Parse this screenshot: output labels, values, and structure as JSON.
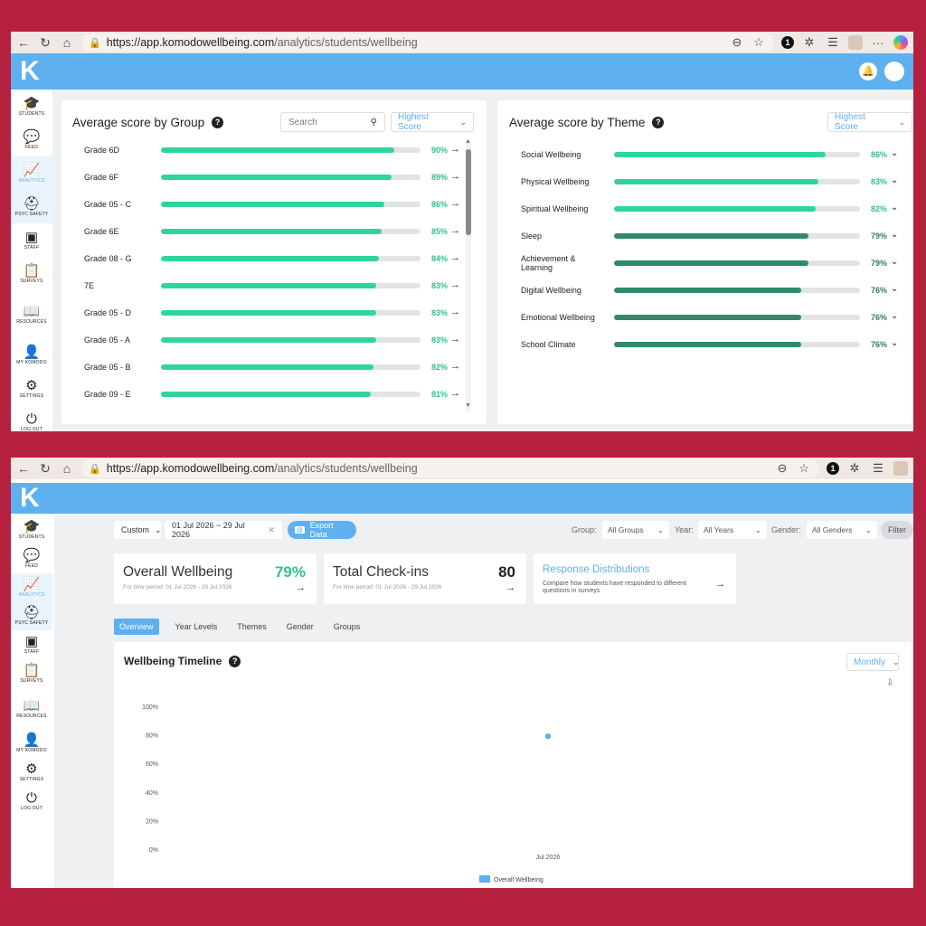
{
  "browser": {
    "url_host": "https://app.komodowellbeing.com",
    "url_path": "/analytics/students/wellbeing",
    "extension_badge": "1"
  },
  "app": {
    "logo_letter": "K"
  },
  "sidebar": {
    "items": [
      {
        "label": "STUDENTS",
        "icon": "graduation-cap-icon"
      },
      {
        "label": "FEED",
        "icon": "chat-bubble-icon"
      },
      {
        "label": "ANALYTICS",
        "icon": "chart-line-icon"
      },
      {
        "label": "PSYC SAFETY",
        "icon": "hard-hat-icon"
      },
      {
        "label": "STAFF",
        "icon": "id-badge-icon"
      },
      {
        "label": "SURVEYS",
        "icon": "clipboard-icon"
      },
      {
        "label": "RESOURCES",
        "icon": "book-icon"
      },
      {
        "label": "MY KOMODO",
        "icon": "person-icon"
      },
      {
        "label": "SETTINGS",
        "icon": "gear-icon"
      },
      {
        "label": "LOG OUT",
        "icon": "power-icon"
      }
    ]
  },
  "group_card": {
    "title": "Average score by Group",
    "search_placeholder": "Search",
    "sort_label": "Highest Score",
    "rows": [
      {
        "label": "Grade 6D",
        "pct": "90%",
        "value": 0.9
      },
      {
        "label": "Grade 6F",
        "pct": "89%",
        "value": 0.89
      },
      {
        "label": "Grade 05 - C",
        "pct": "86%",
        "value": 0.86
      },
      {
        "label": "Grade 6E",
        "pct": "85%",
        "value": 0.85
      },
      {
        "label": "Grade 08 - G",
        "pct": "84%",
        "value": 0.84
      },
      {
        "label": "7E",
        "pct": "83%",
        "value": 0.83
      },
      {
        "label": "Grade 05 - D",
        "pct": "83%",
        "value": 0.83
      },
      {
        "label": "Grade 05 - A",
        "pct": "83%",
        "value": 0.83
      },
      {
        "label": "Grade 05 - B",
        "pct": "82%",
        "value": 0.82
      },
      {
        "label": "Grade 09 - E",
        "pct": "81%",
        "value": 0.81
      }
    ]
  },
  "theme_card": {
    "title": "Average score by Theme",
    "sort_label": "Highest Score",
    "rows": [
      {
        "label": "Social Wellbeing",
        "pct": "86%",
        "value": 0.86,
        "tone": "light"
      },
      {
        "label": "Physical Wellbeing",
        "pct": "83%",
        "value": 0.83,
        "tone": "light"
      },
      {
        "label": "Spiritual Wellbeing",
        "pct": "82%",
        "value": 0.82,
        "tone": "light"
      },
      {
        "label": "Sleep",
        "pct": "79%",
        "value": 0.79,
        "tone": "dark"
      },
      {
        "label": "Achievement &",
        "label2": "Learning",
        "pct": "79%",
        "value": 0.79,
        "tone": "dark"
      },
      {
        "label": "Digital Wellbeing",
        "pct": "76%",
        "value": 0.76,
        "tone": "dark"
      },
      {
        "label": "Emotional Wellbeing",
        "pct": "76%",
        "value": 0.76,
        "tone": "dark"
      },
      {
        "label": "School Climate",
        "pct": "76%",
        "value": 0.76,
        "tone": "dark"
      }
    ]
  },
  "colors": {
    "accent": "#5eb0ef",
    "bar_light": "#2fd698",
    "bar_dark": "#2e8a6a",
    "pct_light": "#2fc38a",
    "pct_dark": "#2e7d62"
  },
  "filters": {
    "range_label": "Custom",
    "date_range": "01 Jul 2026 ~ 29 Jul 2026",
    "export_label": "Export Data",
    "group_label": "Group:",
    "group_value": "All Groups",
    "year_label": "Year:",
    "year_value": "All Years",
    "gender_label": "Gender:",
    "gender_value": "All Genders",
    "filter_button": "Filter"
  },
  "stats": {
    "overall": {
      "title": "Overall Wellbeing",
      "value": "79%",
      "sub": "For time period: 01 Jul 2026 - 29 Jul 2026"
    },
    "checkins": {
      "title": "Total Check-ins",
      "value": "80",
      "sub": "For time period: 01 Jul 2026 - 29 Jul 2026"
    },
    "responses": {
      "title": "Response Distributions",
      "desc": "Compare how students have responded to different questions in surveys"
    }
  },
  "tabs": [
    "Overview",
    "Year Levels",
    "Themes",
    "Gender",
    "Groups"
  ],
  "timeline": {
    "title": "Wellbeing Timeline",
    "interval": "Monthly"
  },
  "chart_data": {
    "type": "line",
    "x": [
      "Jul 2026"
    ],
    "series": [
      {
        "name": "Overall Wellbeing",
        "values": [
          79
        ]
      }
    ],
    "yticks": [
      "100%",
      "80%",
      "60%",
      "40%",
      "20%",
      "0%"
    ],
    "ylim": [
      0,
      100
    ],
    "legend": "bottom",
    "grid": false
  }
}
